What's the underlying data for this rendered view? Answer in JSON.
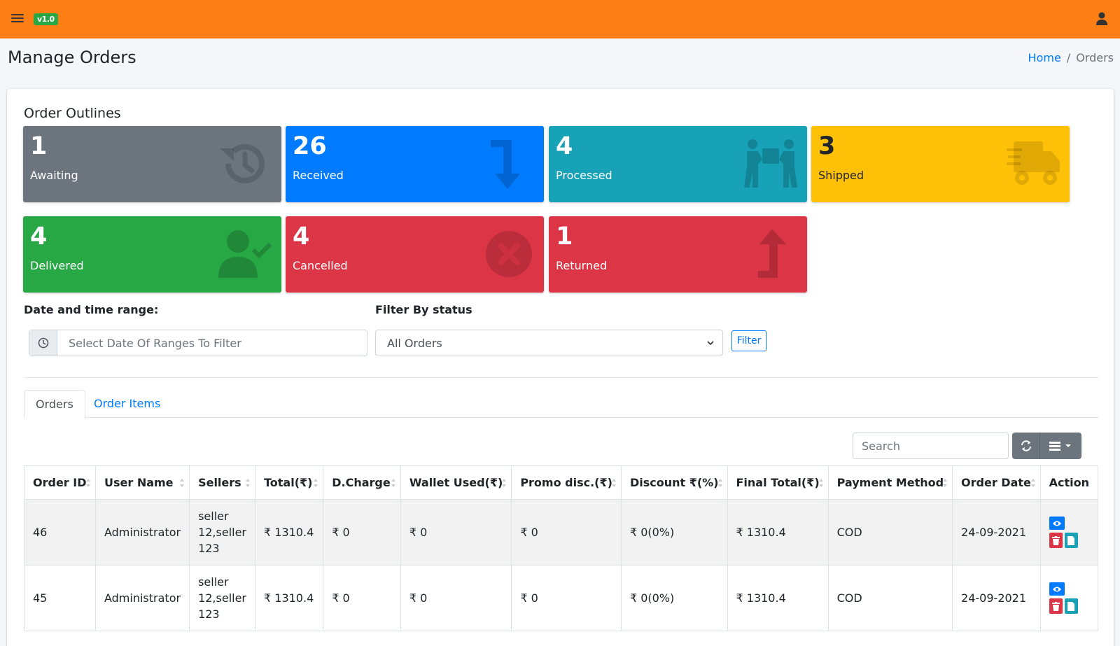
{
  "header": {
    "version_badge": "v1.0",
    "color": "#fd7e14"
  },
  "page": {
    "title": "Manage Orders",
    "breadcrumb": {
      "home": "Home",
      "current": "Orders"
    }
  },
  "outlines": {
    "title": "Order Outlines",
    "boxes": [
      {
        "count": "1",
        "label": "Awaiting",
        "color": "#6c757d",
        "icon": "history-icon"
      },
      {
        "count": "26",
        "label": "Received",
        "color": "#007bff",
        "icon": "arrow-down-turn-icon"
      },
      {
        "count": "4",
        "label": "Processed",
        "color": "#17a2b8",
        "icon": "people-carry-box-icon"
      },
      {
        "count": "3",
        "label": "Shipped",
        "color": "#ffc107",
        "icon": "shipping-truck-icon"
      },
      {
        "count": "4",
        "label": "Delivered",
        "color": "#28a745",
        "icon": "user-check-icon"
      },
      {
        "count": "4",
        "label": "Cancelled",
        "color": "#dc3545",
        "icon": "times-circle-icon"
      },
      {
        "count": "1",
        "label": "Returned",
        "color": "#dc3545",
        "icon": "arrow-up-turn-icon"
      }
    ]
  },
  "filters": {
    "date_label": "Date and time range:",
    "date_placeholder": "Select Date Of Ranges To Filter",
    "status_label": "Filter By status",
    "status_selected": "All Orders",
    "filter_button": "Filter"
  },
  "tabs": {
    "orders": "Orders",
    "order_items": "Order Items"
  },
  "toolbar": {
    "search_placeholder": "Search"
  },
  "table": {
    "columns": [
      "Order ID",
      "User Name",
      "Sellers",
      "Total(₹)",
      "D.Charge",
      "Wallet Used(₹)",
      "Promo disc.(₹)",
      "Discount ₹(%)",
      "Final Total(₹)",
      "Payment Method",
      "Order Date",
      "Action"
    ],
    "rows": [
      {
        "id": "46",
        "user": "Administrator",
        "sellers": "seller 12,seller 123",
        "total": "₹ 1310.4",
        "dcharge": "₹ 0",
        "wallet": "₹ 0",
        "promo": "₹ 0",
        "discount": "₹ 0(0%)",
        "final": "₹ 1310.4",
        "payment": "COD",
        "date": "24-09-2021"
      },
      {
        "id": "45",
        "user": "Administrator",
        "sellers": "seller 12,seller 123",
        "total": "₹ 1310.4",
        "dcharge": "₹ 0",
        "wallet": "₹ 0",
        "promo": "₹ 0",
        "discount": "₹ 0(0%)",
        "final": "₹ 1310.4",
        "payment": "COD",
        "date": "24-09-2021"
      }
    ]
  }
}
